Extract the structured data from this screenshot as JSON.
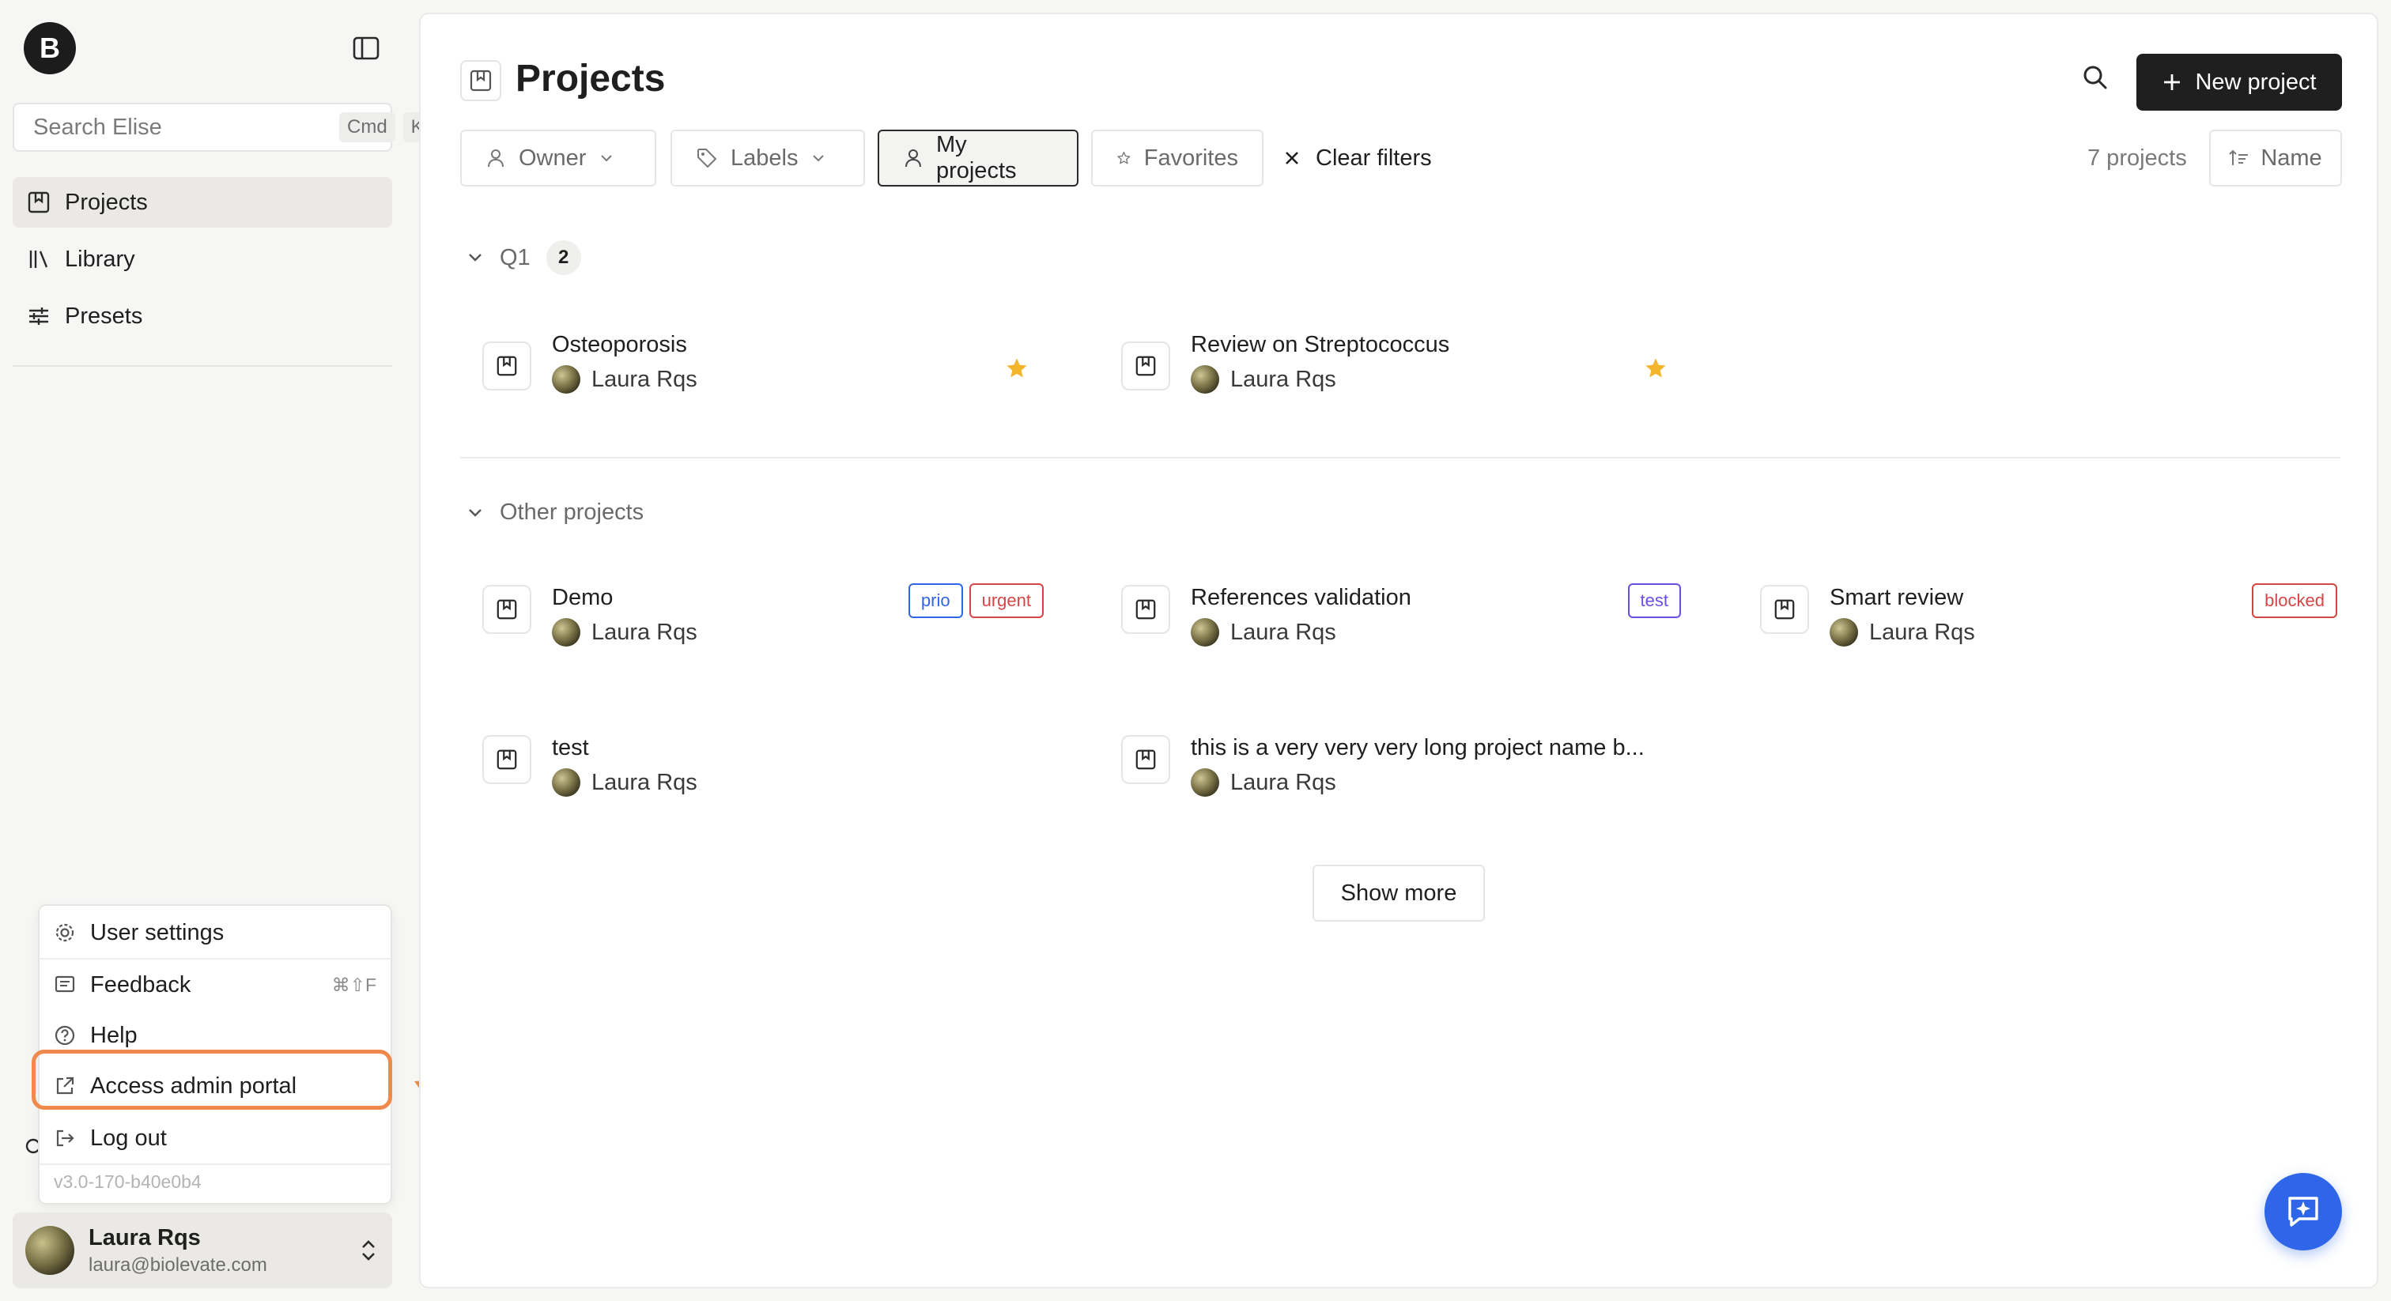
{
  "sidebar": {
    "logo_letter": "B",
    "search": {
      "placeholder": "Search Elise",
      "kbd1": "Cmd",
      "kbd2": "K"
    },
    "nav": [
      {
        "label": "Projects",
        "icon": "bookmark-square-icon"
      },
      {
        "label": "Library",
        "icon": "library-icon"
      },
      {
        "label": "Presets",
        "icon": "sliders-icon"
      }
    ],
    "menu": {
      "user_settings": "User settings",
      "feedback": "Feedback",
      "feedback_shortcut": "⌘⇧F",
      "help": "Help",
      "admin_portal": "Access admin portal",
      "logout": "Log out",
      "version": "v3.0-170-b40e0b4"
    },
    "user": {
      "name": "Laura Rqs",
      "email": "laura@biolevate.com"
    }
  },
  "main": {
    "title": "Projects",
    "new_project_label": "New project",
    "filters": {
      "owner": "Owner",
      "labels": "Labels",
      "my_projects": "My projects",
      "favorites": "Favorites",
      "clear": "Clear filters"
    },
    "count_label": "7 projects",
    "sort_label": "Name",
    "groups": [
      {
        "name": "Q1",
        "count": "2",
        "projects": [
          {
            "name": "Osteoporosis",
            "owner": "Laura Rqs",
            "favorite": true
          },
          {
            "name": "Review on Streptococcus",
            "owner": "Laura Rqs",
            "favorite": true
          }
        ]
      },
      {
        "name": "Other projects",
        "projects": [
          {
            "name": "Demo",
            "owner": "Laura Rqs",
            "tags": [
              "prio",
              "urgent"
            ]
          },
          {
            "name": "References validation",
            "owner": "Laura Rqs",
            "tags": [
              "test"
            ]
          },
          {
            "name": "Smart review",
            "owner": "Laura Rqs",
            "tags": [
              "blocked"
            ]
          },
          {
            "name": "test",
            "owner": "Laura Rqs"
          },
          {
            "name": "this is a very very very long project name b...",
            "owner": "Laura Rqs"
          }
        ]
      }
    ],
    "show_more": "Show more"
  },
  "colors": {
    "highlight": "#ef8a4c",
    "star": "#f2b52b",
    "tag_prio": "#2f66e9",
    "tag_urgent": "#d64545",
    "tag_test": "#6b4de6",
    "tag_blocked": "#d64545",
    "fab": "#2f66e9"
  }
}
